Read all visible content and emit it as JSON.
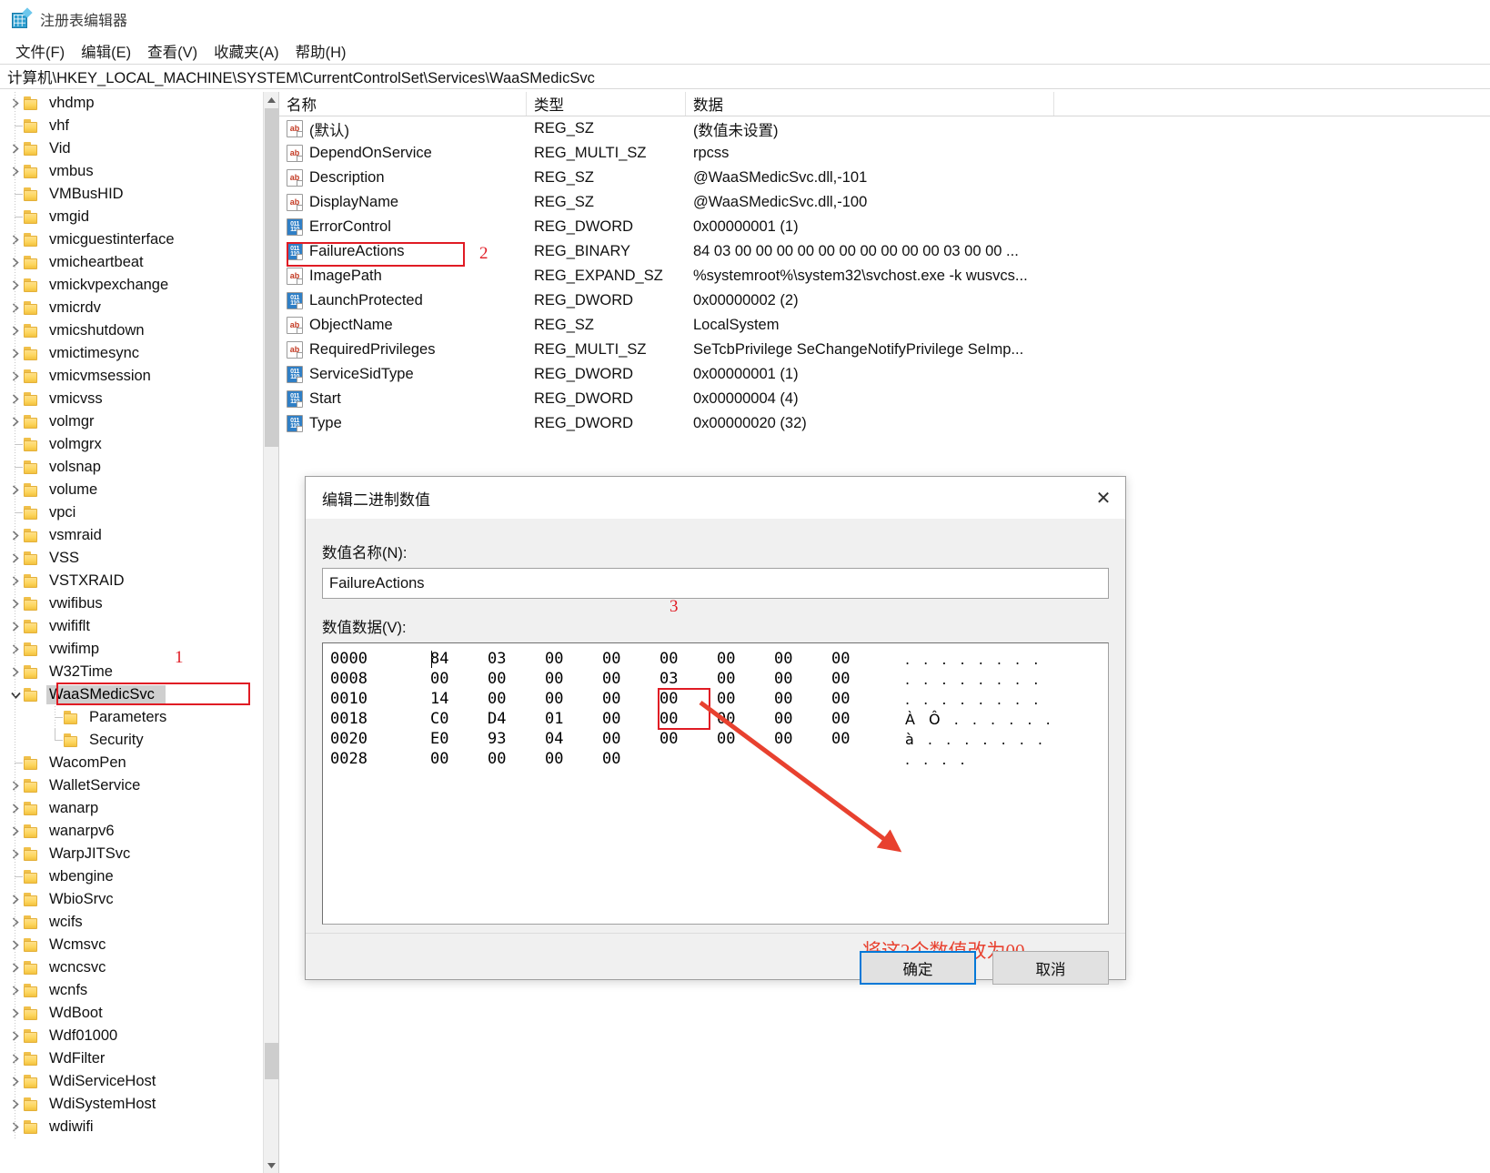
{
  "window": {
    "title": "注册表编辑器",
    "icon": "registry-editor-icon"
  },
  "menubar": {
    "items": [
      {
        "label": "文件(F)",
        "name": "menu-file"
      },
      {
        "label": "编辑(E)",
        "name": "menu-edit"
      },
      {
        "label": "查看(V)",
        "name": "menu-view"
      },
      {
        "label": "收藏夹(A)",
        "name": "menu-favorites"
      },
      {
        "label": "帮助(H)",
        "name": "menu-help"
      }
    ]
  },
  "address": {
    "path": "计算机\\HKEY_LOCAL_MACHINE\\SYSTEM\\CurrentControlSet\\Services\\WaaSMedicSvc"
  },
  "tree": {
    "items": [
      {
        "label": "vhdmp",
        "indent": 1,
        "expander": "collapsed",
        "selected": false
      },
      {
        "label": "vhf",
        "indent": 1,
        "expander": "none",
        "selected": false
      },
      {
        "label": "Vid",
        "indent": 1,
        "expander": "collapsed",
        "selected": false
      },
      {
        "label": "vmbus",
        "indent": 1,
        "expander": "collapsed",
        "selected": false
      },
      {
        "label": "VMBusHID",
        "indent": 1,
        "expander": "none",
        "selected": false
      },
      {
        "label": "vmgid",
        "indent": 1,
        "expander": "none",
        "selected": false
      },
      {
        "label": "vmicguestinterface",
        "indent": 1,
        "expander": "collapsed",
        "selected": false
      },
      {
        "label": "vmicheartbeat",
        "indent": 1,
        "expander": "collapsed",
        "selected": false
      },
      {
        "label": "vmickvpexchange",
        "indent": 1,
        "expander": "collapsed",
        "selected": false
      },
      {
        "label": "vmicrdv",
        "indent": 1,
        "expander": "collapsed",
        "selected": false
      },
      {
        "label": "vmicshutdown",
        "indent": 1,
        "expander": "collapsed",
        "selected": false
      },
      {
        "label": "vmictimesync",
        "indent": 1,
        "expander": "collapsed",
        "selected": false
      },
      {
        "label": "vmicvmsession",
        "indent": 1,
        "expander": "collapsed",
        "selected": false
      },
      {
        "label": "vmicvss",
        "indent": 1,
        "expander": "collapsed",
        "selected": false
      },
      {
        "label": "volmgr",
        "indent": 1,
        "expander": "collapsed",
        "selected": false
      },
      {
        "label": "volmgrx",
        "indent": 1,
        "expander": "none",
        "selected": false
      },
      {
        "label": "volsnap",
        "indent": 1,
        "expander": "none",
        "selected": false
      },
      {
        "label": "volume",
        "indent": 1,
        "expander": "collapsed",
        "selected": false
      },
      {
        "label": "vpci",
        "indent": 1,
        "expander": "none",
        "selected": false
      },
      {
        "label": "vsmraid",
        "indent": 1,
        "expander": "collapsed",
        "selected": false
      },
      {
        "label": "VSS",
        "indent": 1,
        "expander": "collapsed",
        "selected": false
      },
      {
        "label": "VSTXRAID",
        "indent": 1,
        "expander": "collapsed",
        "selected": false
      },
      {
        "label": "vwifibus",
        "indent": 1,
        "expander": "collapsed",
        "selected": false
      },
      {
        "label": "vwififlt",
        "indent": 1,
        "expander": "collapsed",
        "selected": false
      },
      {
        "label": "vwifimp",
        "indent": 1,
        "expander": "collapsed",
        "selected": false
      },
      {
        "label": "W32Time",
        "indent": 1,
        "expander": "collapsed",
        "selected": false
      },
      {
        "label": "WaaSMedicSvc",
        "indent": 1,
        "expander": "expanded",
        "selected": true
      },
      {
        "label": "Parameters",
        "indent": 2,
        "expander": "none",
        "selected": false
      },
      {
        "label": "Security",
        "indent": 2,
        "expander": "none-last",
        "selected": false
      },
      {
        "label": "WacomPen",
        "indent": 1,
        "expander": "none",
        "selected": false
      },
      {
        "label": "WalletService",
        "indent": 1,
        "expander": "collapsed",
        "selected": false
      },
      {
        "label": "wanarp",
        "indent": 1,
        "expander": "collapsed",
        "selected": false
      },
      {
        "label": "wanarpv6",
        "indent": 1,
        "expander": "collapsed",
        "selected": false
      },
      {
        "label": "WarpJITSvc",
        "indent": 1,
        "expander": "collapsed",
        "selected": false
      },
      {
        "label": "wbengine",
        "indent": 1,
        "expander": "none",
        "selected": false
      },
      {
        "label": "WbioSrvc",
        "indent": 1,
        "expander": "collapsed",
        "selected": false
      },
      {
        "label": "wcifs",
        "indent": 1,
        "expander": "collapsed",
        "selected": false
      },
      {
        "label": "Wcmsvc",
        "indent": 1,
        "expander": "collapsed",
        "selected": false
      },
      {
        "label": "wcncsvc",
        "indent": 1,
        "expander": "collapsed",
        "selected": false
      },
      {
        "label": "wcnfs",
        "indent": 1,
        "expander": "collapsed",
        "selected": false
      },
      {
        "label": "WdBoot",
        "indent": 1,
        "expander": "collapsed",
        "selected": false
      },
      {
        "label": "Wdf01000",
        "indent": 1,
        "expander": "collapsed",
        "selected": false
      },
      {
        "label": "WdFilter",
        "indent": 1,
        "expander": "collapsed",
        "selected": false
      },
      {
        "label": "WdiServiceHost",
        "indent": 1,
        "expander": "collapsed",
        "selected": false
      },
      {
        "label": "WdiSystemHost",
        "indent": 1,
        "expander": "collapsed",
        "selected": false
      },
      {
        "label": "wdiwifi",
        "indent": 1,
        "expander": "collapsed",
        "selected": false
      }
    ]
  },
  "values": {
    "columns": [
      "名称",
      "类型",
      "数据"
    ],
    "rows": [
      {
        "icon": "string-value-icon",
        "name": "(默认)",
        "type": "REG_SZ",
        "data": "(数值未设置)"
      },
      {
        "icon": "string-value-icon",
        "name": "DependOnService",
        "type": "REG_MULTI_SZ",
        "data": "rpcss"
      },
      {
        "icon": "string-value-icon",
        "name": "Description",
        "type": "REG_SZ",
        "data": "@WaaSMedicSvc.dll,-101"
      },
      {
        "icon": "string-value-icon",
        "name": "DisplayName",
        "type": "REG_SZ",
        "data": "@WaaSMedicSvc.dll,-100"
      },
      {
        "icon": "binary-value-icon",
        "name": "ErrorControl",
        "type": "REG_DWORD",
        "data": "0x00000001 (1)"
      },
      {
        "icon": "binary-value-icon",
        "name": "FailureActions",
        "type": "REG_BINARY",
        "data": "84 03 00 00 00 00 00 00 00 00 00 00 03 00 00 ..."
      },
      {
        "icon": "string-value-icon",
        "name": "ImagePath",
        "type": "REG_EXPAND_SZ",
        "data": "%systemroot%\\system32\\svchost.exe -k wusvcs..."
      },
      {
        "icon": "binary-value-icon",
        "name": "LaunchProtected",
        "type": "REG_DWORD",
        "data": "0x00000002 (2)"
      },
      {
        "icon": "string-value-icon",
        "name": "ObjectName",
        "type": "REG_SZ",
        "data": "LocalSystem"
      },
      {
        "icon": "string-value-icon",
        "name": "RequiredPrivileges",
        "type": "REG_MULTI_SZ",
        "data": "SeTcbPrivilege SeChangeNotifyPrivilege SeImp..."
      },
      {
        "icon": "binary-value-icon",
        "name": "ServiceSidType",
        "type": "REG_DWORD",
        "data": "0x00000001 (1)"
      },
      {
        "icon": "binary-value-icon",
        "name": "Start",
        "type": "REG_DWORD",
        "data": "0x00000004 (4)"
      },
      {
        "icon": "binary-value-icon",
        "name": "Type",
        "type": "REG_DWORD",
        "data": "0x00000020 (32)"
      }
    ]
  },
  "dialog": {
    "title": "编辑二进制数值",
    "close_label": "✕",
    "name_label": "数值名称(N):",
    "name_value": "FailureActions",
    "data_label": "数值数据(V):",
    "hex_rows": [
      {
        "offset": "0000",
        "bytes": [
          "84",
          "03",
          "00",
          "00",
          "00",
          "00",
          "00",
          "00"
        ],
        "ascii": ". . . . . . . ."
      },
      {
        "offset": "0008",
        "bytes": [
          "00",
          "00",
          "00",
          "00",
          "03",
          "00",
          "00",
          "00"
        ],
        "ascii": ". . . . . . . ."
      },
      {
        "offset": "0010",
        "bytes": [
          "14",
          "00",
          "00",
          "00",
          "00",
          "00",
          "00",
          "00"
        ],
        "ascii": ". . . . . . . ."
      },
      {
        "offset": "0018",
        "bytes": [
          "C0",
          "D4",
          "01",
          "00",
          "00",
          "00",
          "00",
          "00"
        ],
        "ascii": "À Ô . . . . . ."
      },
      {
        "offset": "0020",
        "bytes": [
          "E0",
          "93",
          "04",
          "00",
          "00",
          "00",
          "00",
          "00"
        ],
        "ascii": "à . . . . . . ."
      },
      {
        "offset": "0028",
        "bytes": [
          "00",
          "00",
          "00",
          "00"
        ],
        "ascii": ". . . ."
      }
    ],
    "ok_label": "确定",
    "cancel_label": "取消"
  },
  "annotations": {
    "marker1": "1",
    "marker2": "2",
    "marker3": "3",
    "note": "将这2个数值改为00",
    "color": "#e01b24"
  }
}
